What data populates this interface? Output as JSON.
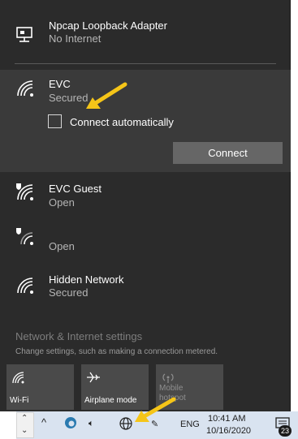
{
  "networks": [
    {
      "title": "Npcap Loopback Adapter",
      "status": "No Internet",
      "icon": "monitor-network-icon"
    },
    {
      "title": "EVC",
      "status": "Secured",
      "icon": "wifi-icon",
      "expanded": true
    },
    {
      "title": "EVC Guest",
      "status": "Open",
      "icon": "wifi-shield-icon"
    },
    {
      "title": "",
      "status": "Open",
      "icon": "wifi-shield-icon"
    },
    {
      "title": "Hidden Network",
      "status": "Secured",
      "icon": "wifi-icon"
    }
  ],
  "evc": {
    "connect_automatically_label": "Connect automatically",
    "connect_automatically_checked": false,
    "connect_button": "Connect"
  },
  "settings": {
    "title": "Network & Internet settings",
    "description": "Change settings, such as making a connection metered."
  },
  "quick_actions": [
    {
      "label": "Wi-Fi",
      "icon": "wifi-icon",
      "enabled": true
    },
    {
      "label": "Airplane mode",
      "icon": "airplane-icon",
      "enabled": true
    },
    {
      "label": "Mobile hotspot",
      "icon": "hotspot-icon",
      "enabled": false
    }
  ],
  "taskbar": {
    "language": "ENG",
    "time": "10:41 AM",
    "date": "10/16/2020",
    "notification_count": "23"
  },
  "colors": {
    "panel_bg": "#2b2b2b",
    "selected_bg": "#3a3a3a",
    "taskbar_bg": "#d9e3f0",
    "annotation_arrow": "#f5c518"
  }
}
